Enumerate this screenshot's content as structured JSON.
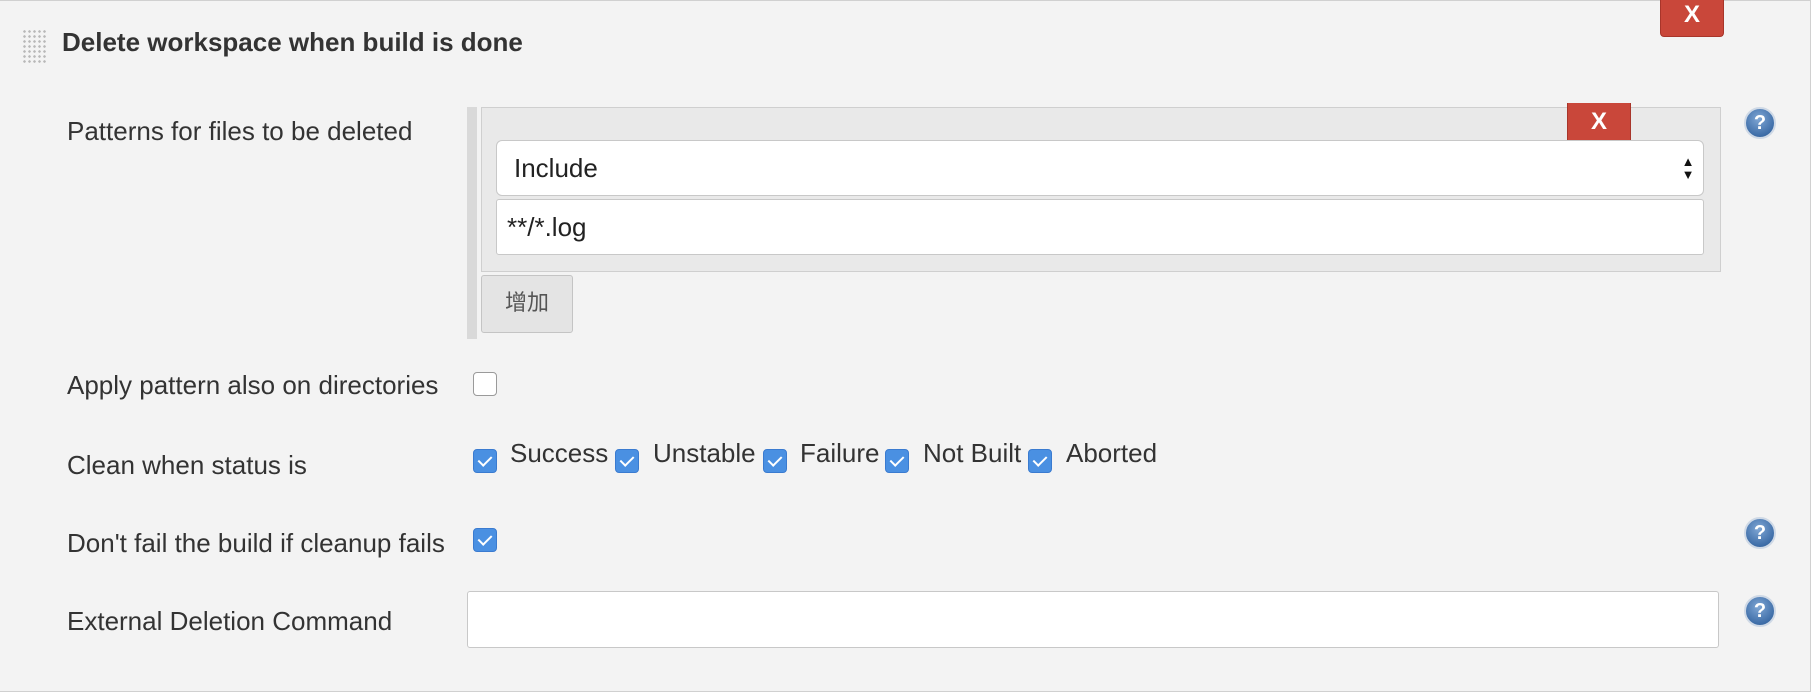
{
  "section": {
    "title": "Delete workspace when build is done",
    "delete_label": "X"
  },
  "patterns": {
    "label": "Patterns for files to be deleted",
    "delete_label": "X",
    "type_selected": "Include",
    "pattern_value": "**/*.log",
    "add_label": "增加"
  },
  "apply_dirs": {
    "label": "Apply pattern also on directories",
    "checked": false
  },
  "clean_status": {
    "label": "Clean when status is",
    "options": [
      {
        "label": "Success",
        "checked": true
      },
      {
        "label": "Unstable",
        "checked": true
      },
      {
        "label": "Failure",
        "checked": true
      },
      {
        "label": "Not Built",
        "checked": true
      },
      {
        "label": "Aborted",
        "checked": true
      }
    ]
  },
  "dont_fail": {
    "label": "Don't fail the build if cleanup fails",
    "checked": true
  },
  "external_command": {
    "label": "External Deletion Command",
    "value": ""
  },
  "help_icon_glyph": "?",
  "colors": {
    "delete_button": "#c9473a",
    "checkbox_checked": "#4a90e2",
    "panel_bg": "#f3f3f3"
  }
}
